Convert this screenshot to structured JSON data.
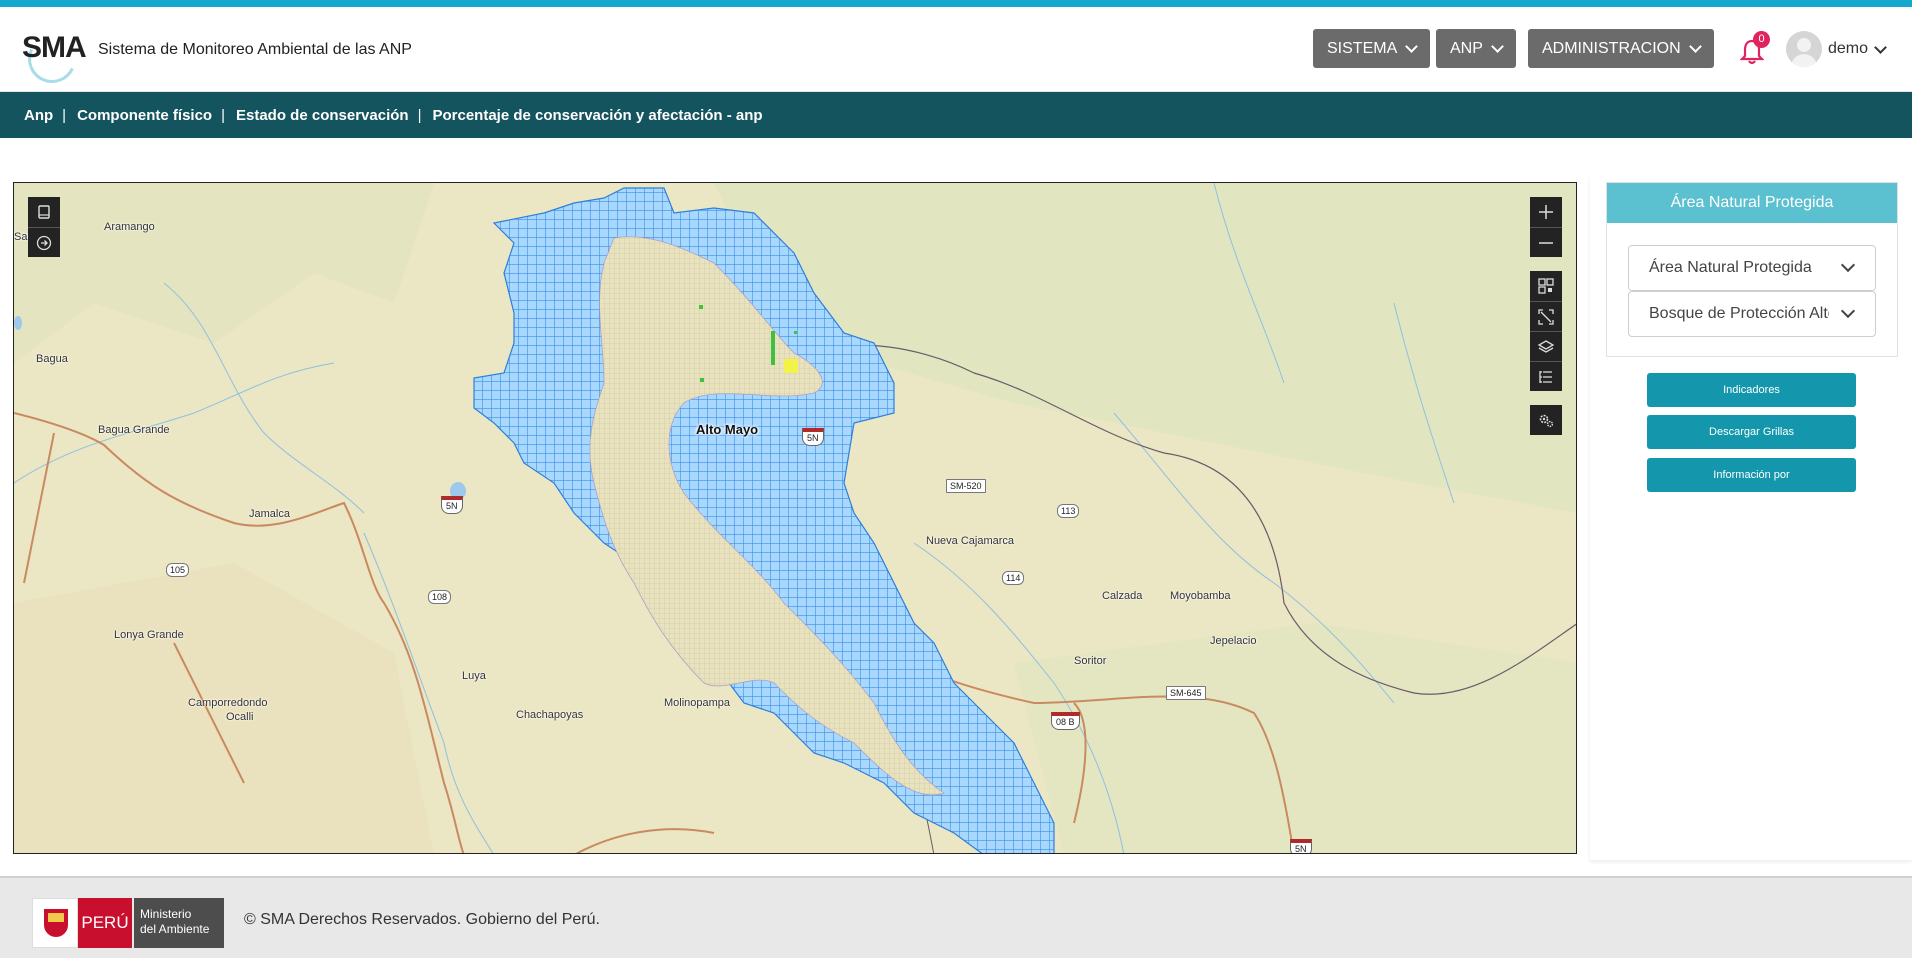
{
  "header": {
    "logo_text": "SMA",
    "app_title": "Sistema de Monitoreo Ambiental de las ANP",
    "nav": [
      {
        "label": "SISTEMA"
      },
      {
        "label": "ANP"
      },
      {
        "label": "ADMINISTRACION"
      }
    ],
    "notification_count": "0",
    "user_name": "demo"
  },
  "breadcrumb": [
    "Anp",
    "Componente físico",
    "Estado de conservación",
    "Porcentaje de conservación y afectación - anp"
  ],
  "map": {
    "place_labels": {
      "aramango": "Aramango",
      "bagua": "Bagua",
      "bagua_grande": "Bagua Grande",
      "jamalca": "Jamalca",
      "lonya_grande": "Lonya Grande",
      "luya": "Luya",
      "camporredondo": "Camporredondo",
      "ocalli": "Ocalli",
      "chachapoyas": "Chachapoyas",
      "molinopampa": "Molinopampa",
      "nueva_cajamarca": "Nueva Cajamarca",
      "calzada": "Calzada",
      "moyobamba": "Moyobamba",
      "jepelacio": "Jepelacio",
      "soritor": "Soritor",
      "alto_mayo": "Alto Mayo",
      "edge_label": "Sant"
    },
    "road_labels": {
      "r5n_a": "5N",
      "r5n_b": "5N",
      "r5n_c": "5N",
      "sm520": "SM-520",
      "r113": "113",
      "r114": "114",
      "r105": "105",
      "r108": "108",
      "sm645": "SM-645",
      "r08b": "08 B"
    },
    "colors": {
      "grid_blue": "#4aa3ff",
      "grid_fill": "#9fd3ff",
      "interior_beige": "#e5dfba",
      "afectacion_green": "#3ec13e",
      "afectacion_yellow": "#ffff33"
    },
    "left_tools": [
      "book-icon",
      "arrow-right-circle-icon"
    ],
    "right_tools": [
      "zoom-in-icon",
      "zoom-out-icon",
      "qr-grid-icon",
      "fullscreen-icon",
      "layers-icon",
      "legend-list-icon",
      "settings-gears-icon"
    ]
  },
  "panel": {
    "title": "Área Natural Protegida",
    "select_type": "Área Natural Protegida",
    "select_anp": "Bosque de Protección Alto Mayo",
    "buttons": {
      "indicadores": "Indicadores",
      "descargar": "Descargar Grillas",
      "informacion": "Información por"
    }
  },
  "footer": {
    "peru": "PERÚ",
    "ministerio_l1": "Ministerio",
    "ministerio_l2": "del Ambiente",
    "copyright": "© SMA Derechos Reservados. Gobierno del Perú."
  }
}
